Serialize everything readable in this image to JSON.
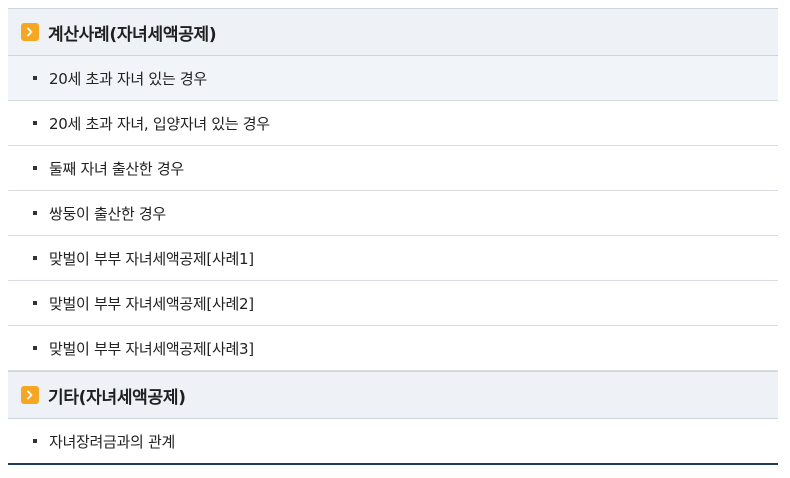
{
  "sections": [
    {
      "title": "계산사례(자녀세액공제)",
      "items": [
        "20세 초과 자녀 있는 경우",
        "20세 초과 자녀, 입양자녀 있는 경우",
        "둘째 자녀 출산한 경우",
        "쌍둥이 출산한 경우",
        "맞벌이 부부 자녀세액공제[사례1]",
        "맞벌이 부부 자녀세액공제[사례2]",
        "맞벌이 부부 자녀세액공제[사례3]"
      ]
    },
    {
      "title": "기타(자녀세액공제)",
      "items": [
        "자녀장려금과의 관계"
      ]
    }
  ],
  "icons": {
    "section_icon": "chevron-right-icon"
  },
  "colors": {
    "section_background": "#eef2f7",
    "section_icon_background": "#f5a623",
    "bottom_border": "#1f3b5c"
  }
}
